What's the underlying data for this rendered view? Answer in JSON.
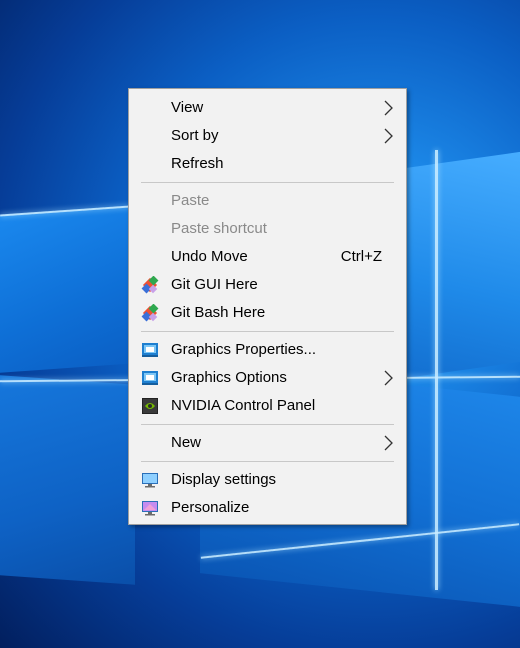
{
  "desktop": {
    "background_color": "#0b5fc4"
  },
  "context_menu": {
    "items": [
      {
        "label": "View",
        "submenu": true,
        "icon": null
      },
      {
        "label": "Sort by",
        "submenu": true,
        "icon": null
      },
      {
        "label": "Refresh",
        "submenu": false,
        "icon": null
      },
      {
        "label": "Paste",
        "disabled": true
      },
      {
        "label": "Paste shortcut",
        "disabled": true
      },
      {
        "label": "Undo Move",
        "shortcut": "Ctrl+Z"
      },
      {
        "label": "Git GUI Here",
        "icon": "git-diamond-icon"
      },
      {
        "label": "Git Bash Here",
        "icon": "git-diamond-icon"
      },
      {
        "label": "Graphics Properties...",
        "icon": "intel-graphics-icon"
      },
      {
        "label": "Graphics Options",
        "icon": "intel-graphics-icon",
        "submenu": true
      },
      {
        "label": "NVIDIA Control Panel",
        "icon": "nvidia-icon"
      },
      {
        "label": "New",
        "submenu": true
      },
      {
        "label": "Display settings",
        "icon": "monitor-icon"
      },
      {
        "label": "Personalize",
        "icon": "personalize-icon"
      }
    ],
    "colors": {
      "background": "#f2f2f2",
      "disabled_text": "#8a8a8a",
      "separator": "#c8c8c8"
    }
  }
}
